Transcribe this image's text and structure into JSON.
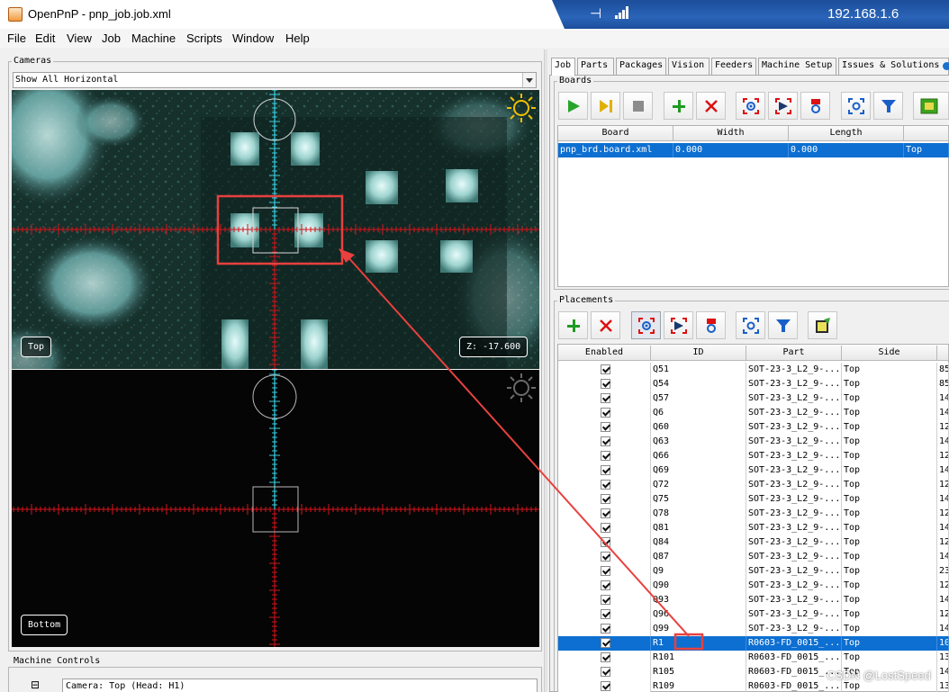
{
  "window": {
    "title": "OpenPnP - pnp_job.job.xml",
    "remote_ip": "192.168.1.6"
  },
  "menu": [
    "File",
    "Edit",
    "View",
    "Job",
    "Machine",
    "Scripts",
    "Window",
    "Help"
  ],
  "cameras": {
    "group_title": "Cameras",
    "layout_value": "Show All Horizontal",
    "top_label": "Top",
    "z_readout": "Z: -17.600",
    "bottom_label": "Bottom"
  },
  "machine_controls": {
    "group_title": "Machine Controls",
    "collapse_symbol": "⊟",
    "camera_value": "Camera: Top (Head: H1)"
  },
  "tabs": [
    {
      "label": "Job",
      "active": true
    },
    {
      "label": "Parts"
    },
    {
      "label": "Packages"
    },
    {
      "label": "Vision"
    },
    {
      "label": "Feeders"
    },
    {
      "label": "Machine Setup"
    },
    {
      "label": "Issues & Solutions"
    }
  ],
  "boards": {
    "group_title": "Boards",
    "toolbar_icons": [
      "play-icon",
      "step-icon",
      "stop-icon",
      "add-icon",
      "remove-icon",
      "position-camera-icon",
      "position-tool-icon",
      "nozzle-icon",
      "fiducial-check-icon",
      "filter-icon",
      "board-image-icon"
    ],
    "columns": [
      "Board",
      "Width",
      "Length",
      ""
    ],
    "rows": [
      {
        "board": "pnp_brd.board.xml",
        "width": "0.000",
        "length": "0.000",
        "side": "Top",
        "selected": true
      }
    ]
  },
  "placements": {
    "group_title": "Placements",
    "toolbar_icons": [
      "add-icon",
      "remove-icon",
      "position-camera-icon",
      "position-tool-icon",
      "nozzle-icon",
      "camera-center-icon",
      "filter-icon",
      "edit-icon"
    ],
    "columns": [
      "Enabled",
      "ID",
      "Part",
      "Side",
      ""
    ],
    "rows": [
      {
        "id": "Q51",
        "part": "SOT-23-3_L2_9-...",
        "side": "Top",
        "extra": "85"
      },
      {
        "id": "Q54",
        "part": "SOT-23-3_L2_9-...",
        "side": "Top",
        "extra": "85"
      },
      {
        "id": "Q57",
        "part": "SOT-23-3_L2_9-...",
        "side": "Top",
        "extra": "14"
      },
      {
        "id": "Q6",
        "part": "SOT-23-3_L2_9-...",
        "side": "Top",
        "extra": "14"
      },
      {
        "id": "Q60",
        "part": "SOT-23-3_L2_9-...",
        "side": "Top",
        "extra": "12"
      },
      {
        "id": "Q63",
        "part": "SOT-23-3_L2_9-...",
        "side": "Top",
        "extra": "14"
      },
      {
        "id": "Q66",
        "part": "SOT-23-3_L2_9-...",
        "side": "Top",
        "extra": "12"
      },
      {
        "id": "Q69",
        "part": "SOT-23-3_L2_9-...",
        "side": "Top",
        "extra": "14"
      },
      {
        "id": "Q72",
        "part": "SOT-23-3_L2_9-...",
        "side": "Top",
        "extra": "12"
      },
      {
        "id": "Q75",
        "part": "SOT-23-3_L2_9-...",
        "side": "Top",
        "extra": "14"
      },
      {
        "id": "Q78",
        "part": "SOT-23-3_L2_9-...",
        "side": "Top",
        "extra": "12"
      },
      {
        "id": "Q81",
        "part": "SOT-23-3_L2_9-...",
        "side": "Top",
        "extra": "14"
      },
      {
        "id": "Q84",
        "part": "SOT-23-3_L2_9-...",
        "side": "Top",
        "extra": "12"
      },
      {
        "id": "Q87",
        "part": "SOT-23-3_L2_9-...",
        "side": "Top",
        "extra": "14"
      },
      {
        "id": "Q9",
        "part": "SOT-23-3_L2_9-...",
        "side": "Top",
        "extra": "23"
      },
      {
        "id": "Q90",
        "part": "SOT-23-3_L2_9-...",
        "side": "Top",
        "extra": "12"
      },
      {
        "id": "Q93",
        "part": "SOT-23-3_L2_9-...",
        "side": "Top",
        "extra": "14"
      },
      {
        "id": "Q96",
        "part": "SOT-23-3_L2_9-...",
        "side": "Top",
        "extra": "12"
      },
      {
        "id": "Q99",
        "part": "SOT-23-3_L2_9-...",
        "side": "Top",
        "extra": "14"
      },
      {
        "id": "R1",
        "part": "R0603-FD_0015_...",
        "side": "Top",
        "extra": "10",
        "selected": true
      },
      {
        "id": "R101",
        "part": "R0603-FD_0015_...",
        "side": "Top",
        "extra": "13"
      },
      {
        "id": "R105",
        "part": "R0603-FD_0015_...",
        "side": "Top",
        "extra": "14"
      },
      {
        "id": "R109",
        "part": "R0603-FD_0015_...",
        "side": "Top",
        "extra": "13"
      }
    ]
  },
  "watermark": "CSDN @LostSpeed",
  "colors": {
    "selection": "#0d6fd1",
    "annotation": "#e8413f",
    "reticle_red": "#d8141c",
    "reticle_cyan": "#38d0e0"
  }
}
